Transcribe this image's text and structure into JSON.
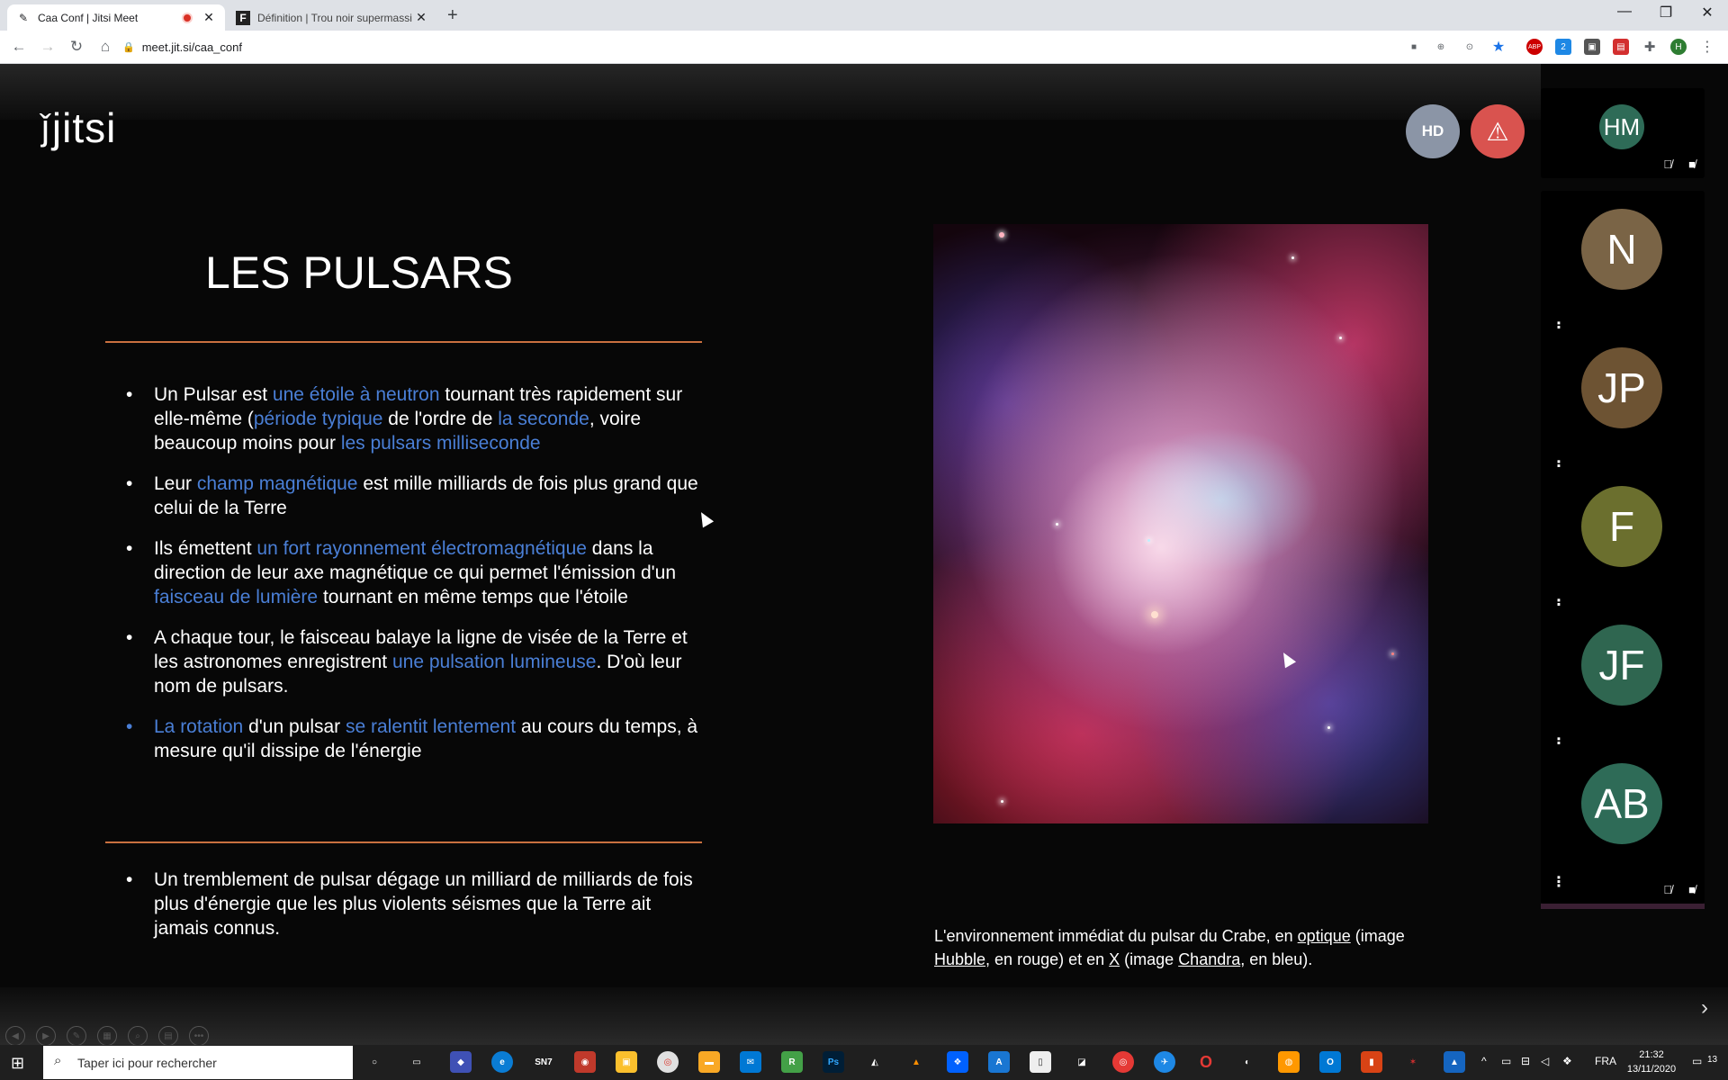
{
  "browser": {
    "tabs": [
      {
        "title": "Caa Conf | Jitsi Meet",
        "favicon": "jitsi-favicon"
      },
      {
        "title": "Définition | Trou noir supermassi",
        "favicon": "F"
      }
    ],
    "new_tab": "+",
    "url": "meet.jit.si/caa_conf",
    "window_controls": [
      "—",
      "❐",
      "✕"
    ]
  },
  "meeting": {
    "logo_text": "jitsi",
    "hd_badge": "HD",
    "warning_icon": "⚠"
  },
  "slide": {
    "title": "LES PULSARS",
    "bullets": [
      [
        {
          "t": "Un Pulsar est "
        },
        {
          "t": "une étoile à neutron",
          "h": true
        },
        {
          "t": " tournant très rapidement sur elle-même ("
        },
        {
          "t": "période typique",
          "h": true
        },
        {
          "t": " de l'ordre de "
        },
        {
          "t": "la seconde",
          "h": true
        },
        {
          "t": ", voire beaucoup moins pour "
        },
        {
          "t": "les pulsars milliseconde",
          "h": true
        }
      ],
      [
        {
          "t": "Leur "
        },
        {
          "t": "champ magnétique",
          "h": true
        },
        {
          "t": " est mille milliards de fois plus grand que celui de la Terre"
        }
      ],
      [
        {
          "t": "Ils émettent "
        },
        {
          "t": "un fort rayonnement électromagnétique",
          "h": true
        },
        {
          "t": " dans la direction de leur axe magnétique ce qui permet l'émission d'un "
        },
        {
          "t": "faisceau de lumière",
          "h": true
        },
        {
          "t": " tournant en même temps que l'étoile"
        }
      ],
      [
        {
          "t": "A chaque tour, le faisceau balaye la ligne de visée de la Terre et les astronomes enregistrent "
        },
        {
          "t": "une pulsation lumineuse",
          "h": true
        },
        {
          "t": ". D'où leur nom de pulsars."
        }
      ],
      [
        {
          "t": "La rotation",
          "h": true
        },
        {
          "t": " d'un pulsar "
        },
        {
          "t": "se ralentit lentement",
          "h": true
        },
        {
          "t": " au cours du temps, à mesure qu'il dissipe de l'énergie"
        }
      ]
    ],
    "final_bullet": "Un tremblement de pulsar dégage un milliard de milliards de fois plus d'énergie que les plus violents séismes que la Terre ait jamais connus.",
    "caption": [
      {
        "t": "L'environnement immédiat du pulsar du Crabe, en "
      },
      {
        "t": "optique",
        "u": true
      },
      {
        "t": " (image "
      },
      {
        "t": "Hubble",
        "u": true
      },
      {
        "t": ", en rouge) et en "
      },
      {
        "t": "X",
        "u": true
      },
      {
        "t": " (image "
      },
      {
        "t": "Chandra",
        "u": true
      },
      {
        "t": ", en bleu)."
      }
    ],
    "image_alt": "crab-nebula-image"
  },
  "participants": [
    {
      "initials": "HM",
      "color": "#2e6b57"
    },
    {
      "initials": "N",
      "color": "#7a6446"
    },
    {
      "initials": "JP",
      "color": "#6d5333"
    },
    {
      "initials": "F",
      "color": "#6b6f2e"
    },
    {
      "initials": "JF",
      "color": "#2f6650"
    },
    {
      "initials": "AB",
      "color": "#2e6b57"
    }
  ],
  "taskbar": {
    "search_placeholder": "Taper ici pour rechercher",
    "language": "FRA",
    "time": "21:32",
    "date": "13/11/2020",
    "notifications": "13"
  }
}
